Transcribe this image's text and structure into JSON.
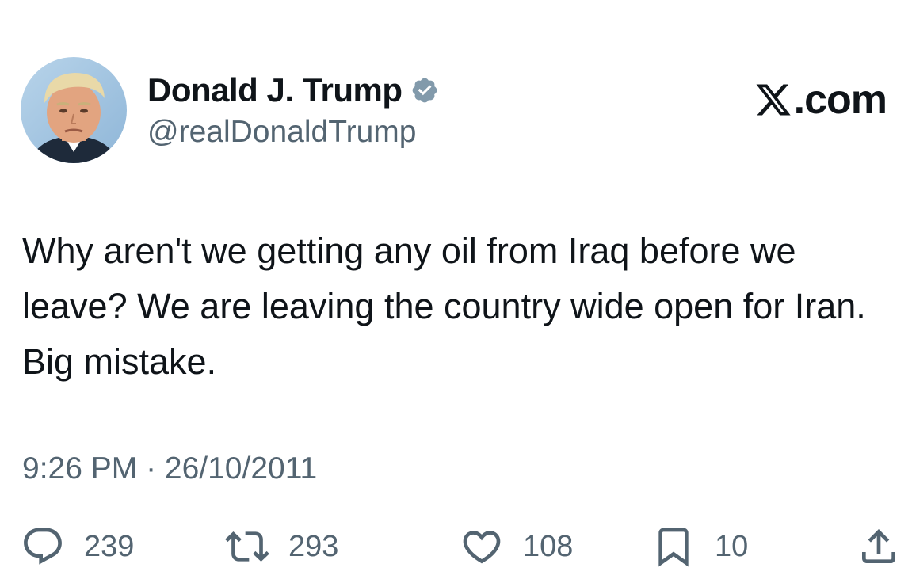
{
  "author": {
    "display_name": "Donald J. Trump",
    "handle": "@realDonaldTrump",
    "verified": true,
    "verified_color": "#829aab",
    "avatar": "profile-photo"
  },
  "brand": {
    "label": ".com",
    "logo": "x-logo"
  },
  "tweet": {
    "text": "Why aren't we getting any oil from Iraq before we leave? We are leaving the country wide open for Iran. Big mistake.",
    "timestamp": "9:26 PM · 26/10/2011"
  },
  "actions": {
    "reply": {
      "icon": "reply-icon",
      "count": "239"
    },
    "retweet": {
      "icon": "retweet-icon",
      "count": "293"
    },
    "like": {
      "icon": "heart-icon",
      "count": "108"
    },
    "bookmark": {
      "icon": "bookmark-icon",
      "count": "10"
    },
    "share": {
      "icon": "share-icon"
    }
  },
  "colors": {
    "text_primary": "#0f1419",
    "text_secondary": "#536471",
    "background": "#ffffff"
  }
}
